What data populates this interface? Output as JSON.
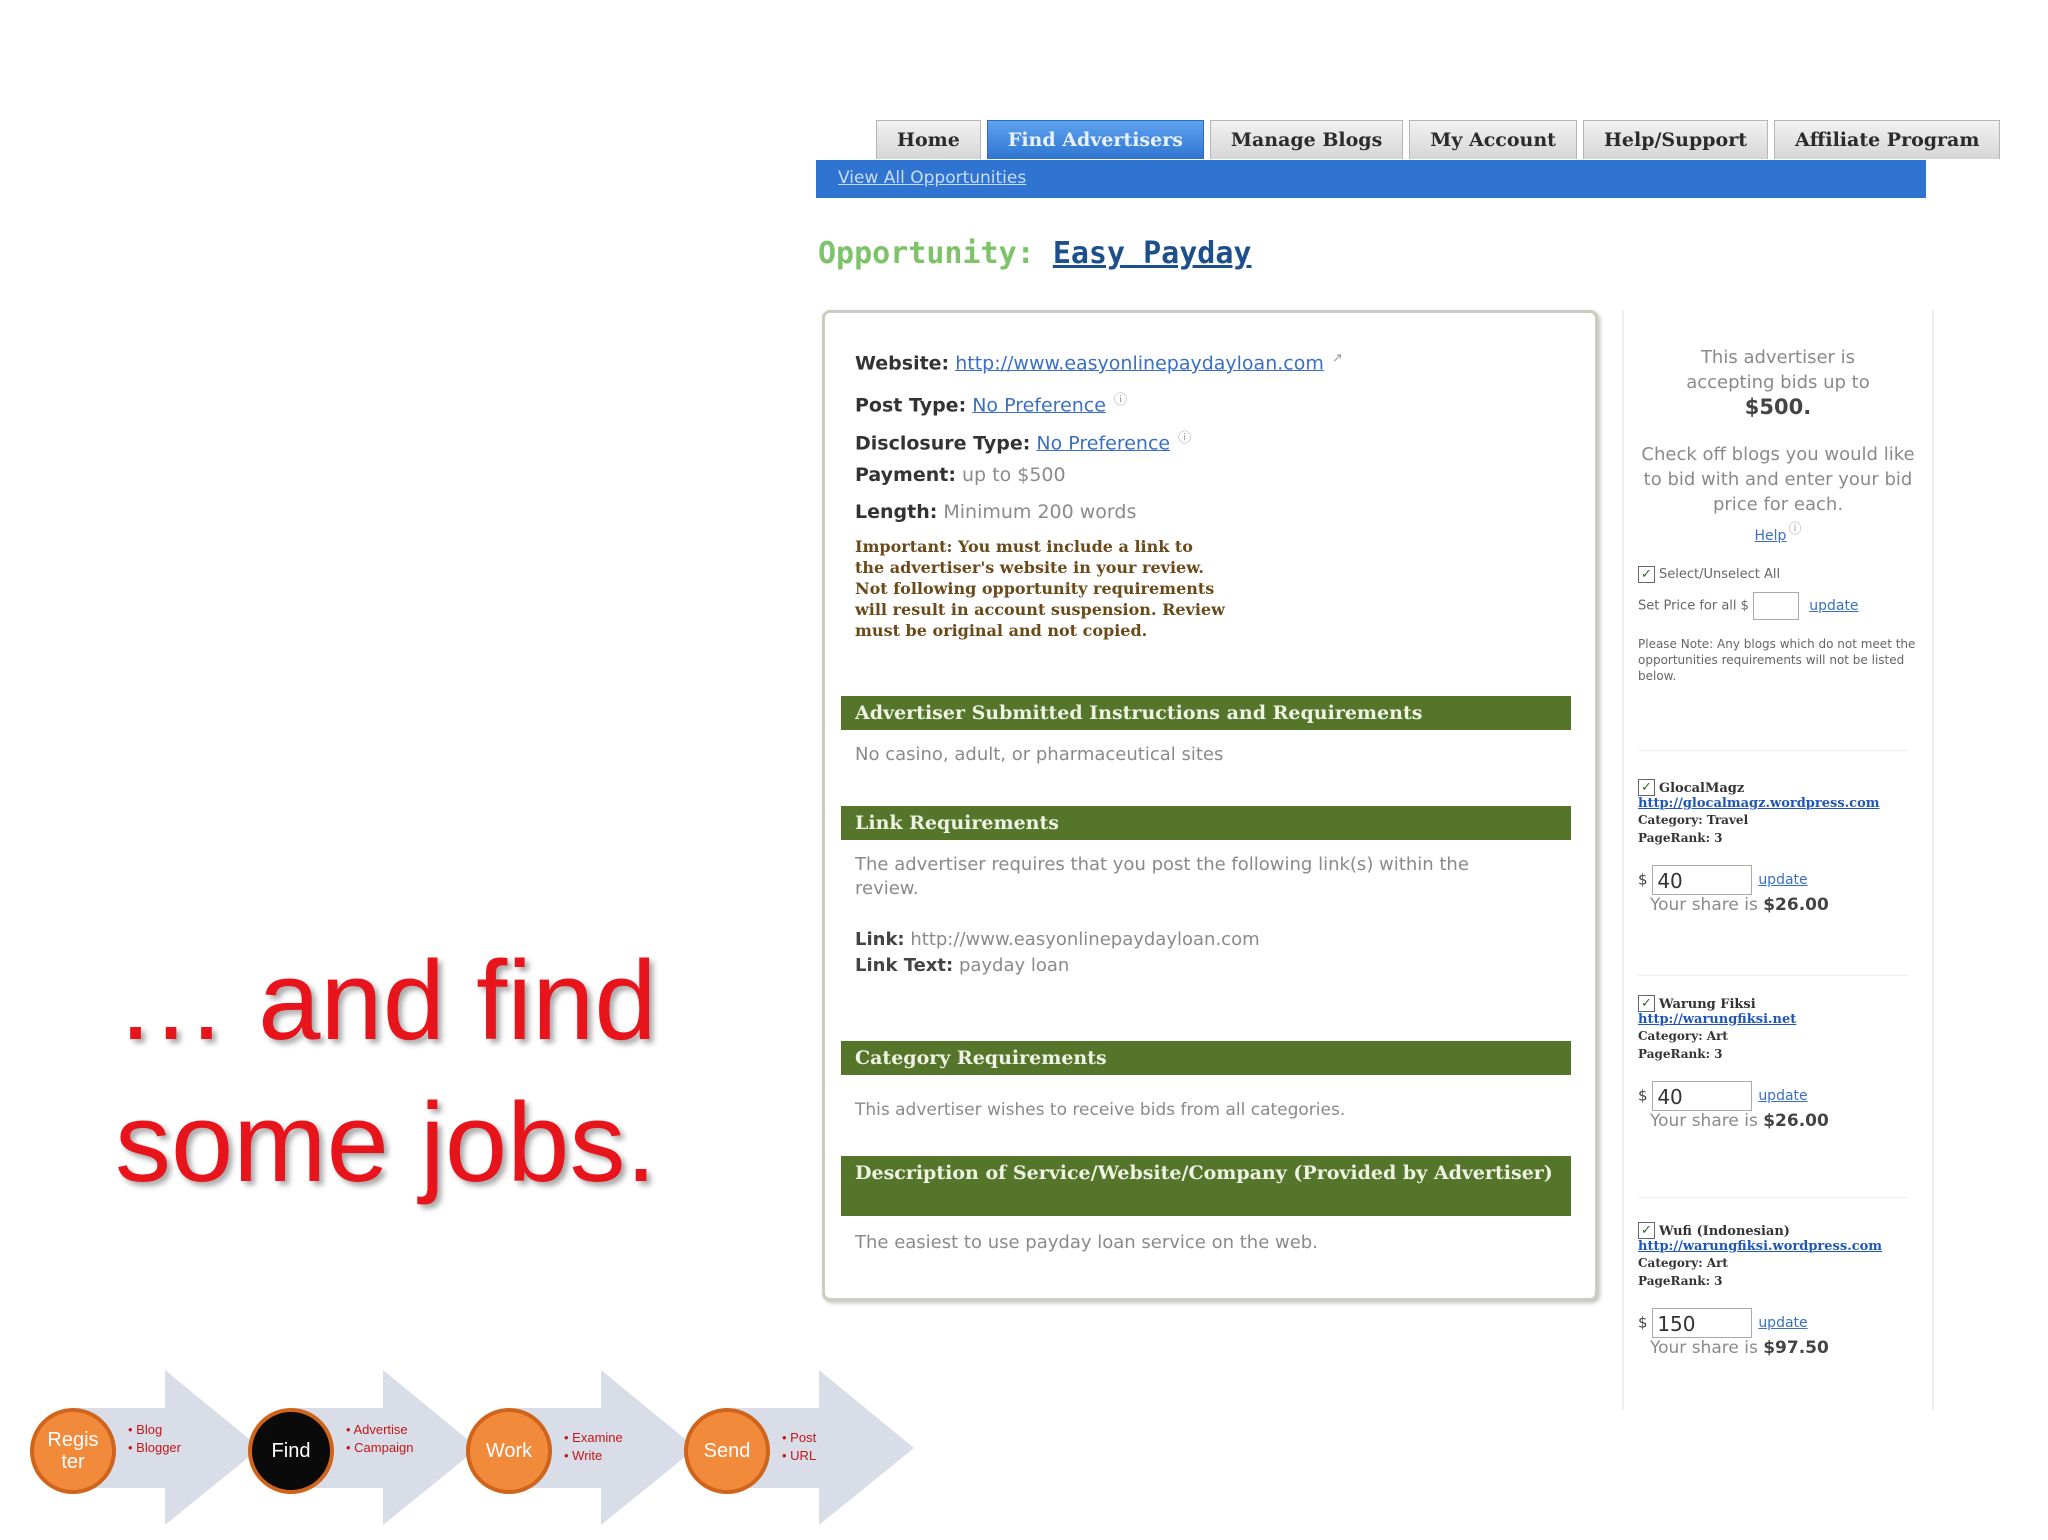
{
  "slide": {
    "headline_line1": "… and find",
    "headline_line2": "some jobs."
  },
  "nav": {
    "tabs": [
      "Home",
      "Find Advertisers",
      "Manage Blogs",
      "My Account",
      "Help/Support",
      "Affiliate Program"
    ],
    "active_tab": "Find Advertisers",
    "sub_link": "View All Opportunities"
  },
  "opportunity": {
    "label": "Opportunity:",
    "name": "Easy Payday",
    "website_label": "Website:",
    "website_url": "http://www.easyonlinepaydayloan.com",
    "post_type_label": "Post Type:",
    "post_type_value": "No Preference",
    "disclosure_label": "Disclosure Type:",
    "disclosure_value": "No Preference",
    "payment_label": "Payment:",
    "payment_value": "up to $500",
    "length_label": "Length:",
    "length_value": "Minimum 200 words",
    "important": "Important: You must include a link to the advertiser's website in your review. Not following opportunity requirements will result in account suspension. Review must be original and not copied."
  },
  "sections": {
    "instructions_title": "Advertiser Submitted Instructions and Requirements",
    "instructions_text": "No casino, adult, or pharmaceutical sites",
    "link_req_title": "Link Requirements",
    "link_req_text": "The advertiser requires that you post the following link(s) within the review.",
    "link_label": "Link:",
    "link_value": "http://www.easyonlinepaydayloan.com",
    "link_text_label": "Link Text:",
    "link_text_value": "payday loan",
    "category_title": "Category Requirements",
    "category_text": "This advertiser wishes to receive bids from all categories.",
    "description_title": "Description of Service/Website/Company (Provided by Advertiser)",
    "description_text": "The easiest to use payday loan service on the web."
  },
  "sidebar": {
    "accepting_text": "This advertiser is accepting bids up to",
    "accepting_amount": "$500.",
    "instructions": "Check off blogs you would like to bid with and enter your bid price for each.",
    "help": "Help",
    "select_all": "Select/Unselect All",
    "set_price_label": "Set Price for all $",
    "update": "update",
    "note": "Please Note: Any blogs which do not meet the opportunities requirements will not be listed below.",
    "blogs": [
      {
        "name": "GlocalMagz",
        "url": "http://glocalmagz.wordpress.com",
        "category": "Category: Travel",
        "pagerank": "PageRank: 3",
        "bid": "40",
        "share_label": "Your share is",
        "share": "$26.00"
      },
      {
        "name": "Warung Fiksi",
        "url": "http://warungfiksi.net",
        "category": "Category: Art",
        "pagerank": "PageRank: 3",
        "bid": "40",
        "share_label": "Your share is",
        "share": "$26.00"
      },
      {
        "name": "Wufi (Indonesian)",
        "url": "http://warungfiksi.wordpress.com",
        "category": "Category: Art",
        "pagerank": "PageRank: 3",
        "bid": "150",
        "share_label": "Your share is",
        "share": "$97.50"
      }
    ]
  },
  "flow": {
    "steps": [
      {
        "label": "Regis ter",
        "bullets": [
          "Blog",
          "Blogger"
        ],
        "style": "orange"
      },
      {
        "label": "Find",
        "bullets": [
          "Advertise",
          "Campaign"
        ],
        "style": "black"
      },
      {
        "label": "Work",
        "bullets": [
          "Examine",
          "Write"
        ],
        "style": "orange"
      },
      {
        "label": "Send",
        "bullets": [
          "Post",
          "URL"
        ],
        "style": "orange"
      }
    ],
    "colors": {
      "circle": "#f28a3c",
      "circle_border": "#d0641b",
      "arrow": "#d9dde8",
      "bullet_text": "#c01818"
    }
  }
}
